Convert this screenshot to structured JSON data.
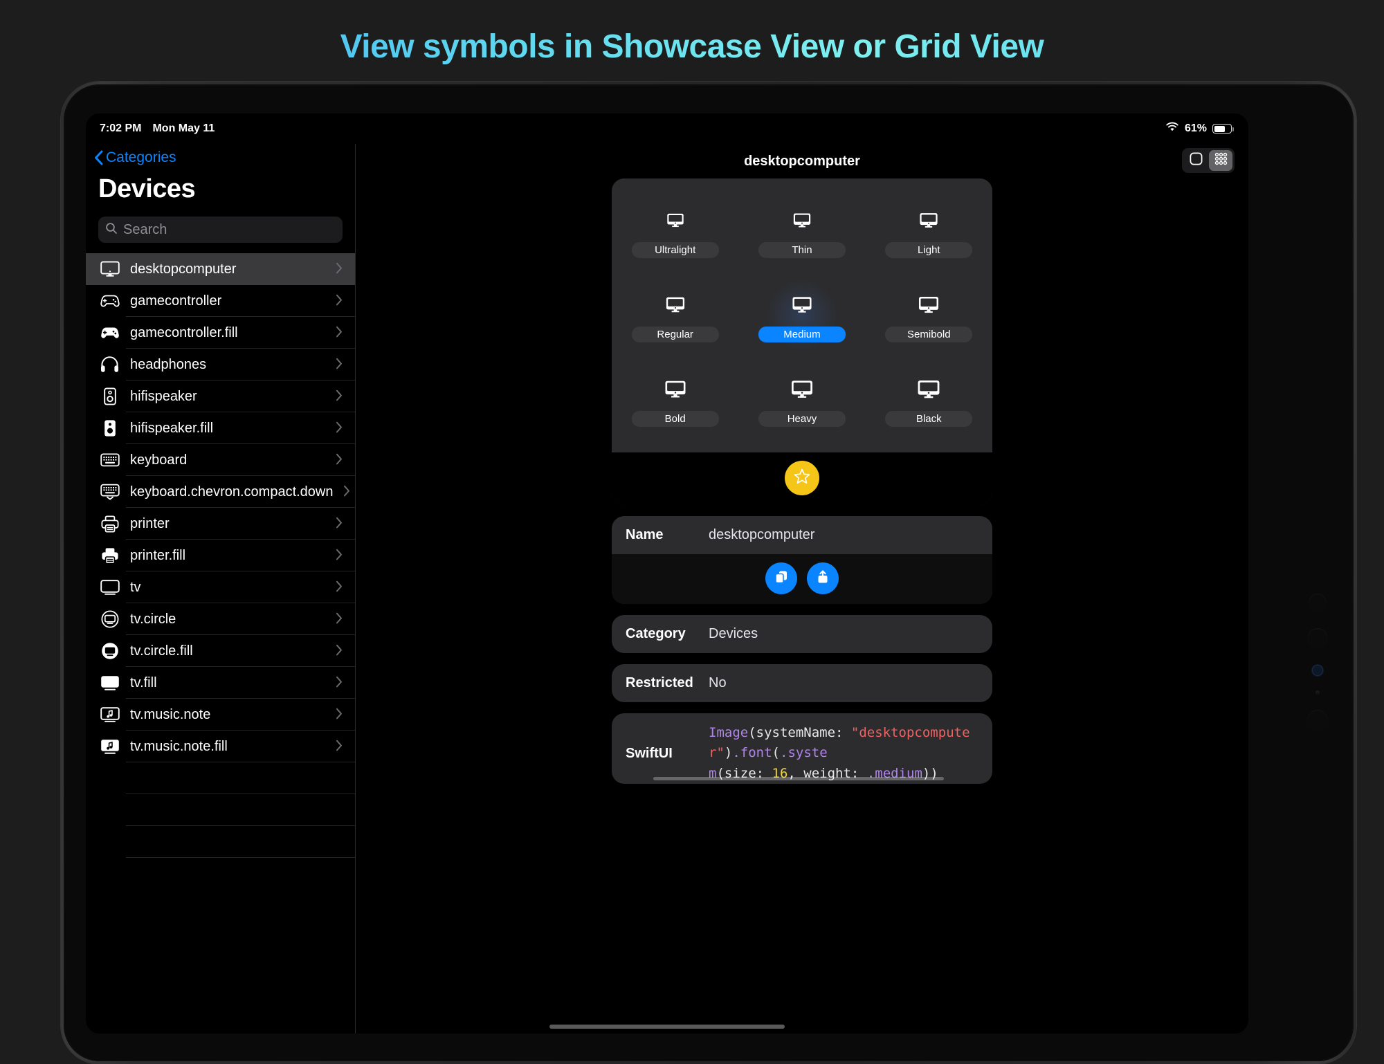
{
  "page": {
    "title": "View symbols in Showcase View or Grid View"
  },
  "statusbar": {
    "time": "7:02 PM",
    "date": "Mon May 11",
    "battery_percent": "61%",
    "wifi_icon": "wifi-icon",
    "battery_icon": "battery-icon"
  },
  "sidebar": {
    "back_label": "Categories",
    "title": "Devices",
    "search_placeholder": "Search",
    "items": [
      {
        "label": "desktopcomputer",
        "icon": "desktopcomputer-icon",
        "selected": true
      },
      {
        "label": "gamecontroller",
        "icon": "gamecontroller-icon",
        "selected": false
      },
      {
        "label": "gamecontroller.fill",
        "icon": "gamecontroller-fill-icon",
        "selected": false
      },
      {
        "label": "headphones",
        "icon": "headphones-icon",
        "selected": false
      },
      {
        "label": "hifispeaker",
        "icon": "hifispeaker-icon",
        "selected": false
      },
      {
        "label": "hifispeaker.fill",
        "icon": "hifispeaker-fill-icon",
        "selected": false
      },
      {
        "label": "keyboard",
        "icon": "keyboard-icon",
        "selected": false
      },
      {
        "label": "keyboard.chevron.compact.down",
        "icon": "keyboard-chevron-compact-down-icon",
        "selected": false
      },
      {
        "label": "printer",
        "icon": "printer-icon",
        "selected": false
      },
      {
        "label": "printer.fill",
        "icon": "printer-fill-icon",
        "selected": false
      },
      {
        "label": "tv",
        "icon": "tv-icon",
        "selected": false
      },
      {
        "label": "tv.circle",
        "icon": "tv-circle-icon",
        "selected": false
      },
      {
        "label": "tv.circle.fill",
        "icon": "tv-circle-fill-icon",
        "selected": false
      },
      {
        "label": "tv.fill",
        "icon": "tv-fill-icon",
        "selected": false
      },
      {
        "label": "tv.music.note",
        "icon": "tv-music-note-icon",
        "selected": false
      },
      {
        "label": "tv.music.note.fill",
        "icon": "tv-music-note-fill-icon",
        "selected": false
      }
    ]
  },
  "detail": {
    "title": "desktopcomputer",
    "view_toggle": {
      "showcase_label": "showcase-view",
      "grid_label": "grid-view",
      "selected": "grid-view"
    },
    "showcase": {
      "weights": [
        {
          "label": "Ultralight",
          "selected": false
        },
        {
          "label": "Thin",
          "selected": false
        },
        {
          "label": "Light",
          "selected": false
        },
        {
          "label": "Regular",
          "selected": false
        },
        {
          "label": "Medium",
          "selected": true
        },
        {
          "label": "Semibold",
          "selected": false
        },
        {
          "label": "Bold",
          "selected": false
        },
        {
          "label": "Heavy",
          "selected": false
        },
        {
          "label": "Black",
          "selected": false
        }
      ],
      "favorite_icon": "star-icon"
    },
    "info": {
      "name_key": "Name",
      "name_value": "desktopcomputer",
      "copy_icon": "copy-icon",
      "share_icon": "share-icon",
      "category_key": "Category",
      "category_value": "Devices",
      "restricted_key": "Restricted",
      "restricted_value": "No",
      "swiftui_key": "SwiftUI"
    },
    "code": {
      "p1": "Image",
      "p2": "(systemName: ",
      "p3": "\"desktopcomputer\"",
      "p4": ")",
      "p5": ".font",
      "p6": "(",
      "p7": ".syste\nm",
      "p8": "(size: ",
      "p9": "16",
      "p10": ", weight: ",
      "p11": ".medium",
      "p12": "))"
    }
  },
  "colors": {
    "accent_blue": "#0a84ff",
    "favorite_yellow": "#f5c518",
    "card_gray": "#2c2c2e",
    "title_gradient_start": "#3aa8f5",
    "title_gradient_end": "#7ff0f0"
  }
}
